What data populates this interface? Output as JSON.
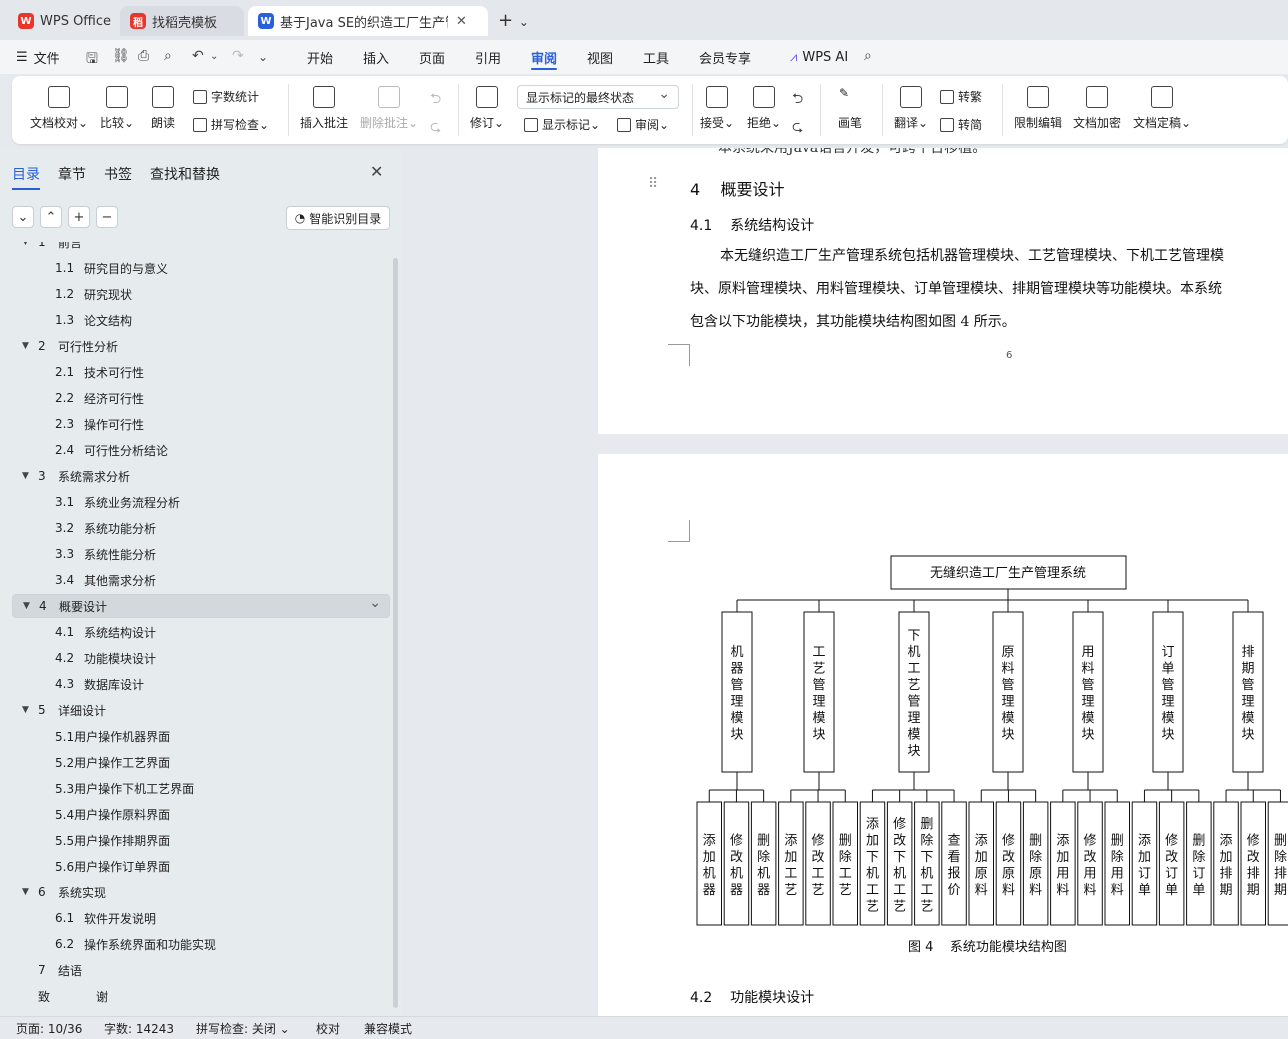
{
  "tabs": [
    {
      "label": "WPS Office",
      "icon": "wps-logo-icon",
      "color": "#e8362d"
    },
    {
      "label": "找稻壳模板",
      "icon": "docer-icon",
      "color": "#e8362d"
    },
    {
      "label": "基于Java SE的织造工厂生产管",
      "icon": "word-doc-icon",
      "color": "#2b5fd9"
    }
  ],
  "menu": {
    "file": "文件",
    "items": [
      "开始",
      "插入",
      "页面",
      "引用",
      "审阅",
      "视图",
      "工具",
      "会员专享"
    ],
    "active": "审阅",
    "ai": "WPS AI"
  },
  "ribbon": {
    "doc_check": "文档校对",
    "compare": "比较",
    "read": "朗读",
    "word_count": "字数统计",
    "spell": "拼写检查",
    "insert_comment": "插入批注",
    "delete_comment": "删除批注",
    "revise": "修订",
    "markup_state": "显示标记的最终状态",
    "show_markup": "显示标记",
    "review": "审阅",
    "accept": "接受",
    "reject": "拒绝",
    "pen": "画笔",
    "translate": "翻译",
    "to_trad": "转繁",
    "to_simp": "转简",
    "restrict": "限制编辑",
    "encrypt": "文档加密",
    "finalize": "文档定稿"
  },
  "panel": {
    "tabs": [
      "目录",
      "章节",
      "书签",
      "查找和替换"
    ],
    "smart": "智能识别目录",
    "toc": [
      {
        "num": "1",
        "text": "前言",
        "level": 1
      },
      {
        "num": "1.1",
        "text": "研究目的与意义",
        "level": 2
      },
      {
        "num": "1.2",
        "text": "研究现状",
        "level": 2
      },
      {
        "num": "1.3",
        "text": "论文结构",
        "level": 2
      },
      {
        "num": "2",
        "text": "可行性分析",
        "level": 1
      },
      {
        "num": "2.1",
        "text": "技术可行性",
        "level": 2
      },
      {
        "num": "2.2",
        "text": "经济可行性",
        "level": 2
      },
      {
        "num": "2.3",
        "text": "操作可行性",
        "level": 2
      },
      {
        "num": "2.4",
        "text": "可行性分析结论",
        "level": 2
      },
      {
        "num": "3",
        "text": "系统需求分析",
        "level": 1
      },
      {
        "num": "3.1",
        "text": "系统业务流程分析",
        "level": 2
      },
      {
        "num": "3.2",
        "text": "系统功能分析",
        "level": 2
      },
      {
        "num": "3.3",
        "text": "系统性能分析",
        "level": 2
      },
      {
        "num": "3.4",
        "text": "其他需求分析",
        "level": 2
      },
      {
        "num": "4",
        "text": "概要设计",
        "level": 1,
        "selected": true
      },
      {
        "num": "4.1",
        "text": "系统结构设计",
        "level": 2
      },
      {
        "num": "4.2",
        "text": "功能模块设计",
        "level": 2
      },
      {
        "num": "4.3",
        "text": "数据库设计",
        "level": 2
      },
      {
        "num": "5",
        "text": "详细设计",
        "level": 1
      },
      {
        "num": "",
        "text": "5.1用户操作机器界面",
        "level": 2
      },
      {
        "num": "",
        "text": "5.2用户操作工艺界面",
        "level": 2
      },
      {
        "num": "",
        "text": "5.3用户操作下机工艺界面",
        "level": 2
      },
      {
        "num": "",
        "text": "5.4用户操作原料界面",
        "level": 2
      },
      {
        "num": "",
        "text": "5.5用户操作排期界面",
        "level": 2
      },
      {
        "num": "",
        "text": "5.6用户操作订单界面",
        "level": 2
      },
      {
        "num": "6",
        "text": "系统实现",
        "level": 1
      },
      {
        "num": "6.1",
        "text": "软件开发说明",
        "level": 2
      },
      {
        "num": "6.2",
        "text": "操作系统界面和功能实现",
        "level": 2
      },
      {
        "num": "7",
        "text": "结语",
        "level": 0
      },
      {
        "num": "致",
        "text": "谢",
        "level": 0
      }
    ]
  },
  "doc": {
    "cut_line": "本系统采用Java语言开发，可跨平台移植。",
    "h1_num": "4",
    "h1": "概要设计",
    "h2_num": "4.1",
    "h2": "系统结构设计",
    "para": [
      "本无缝织造工厂生产管理系统包括机器管理模块、工艺管理模块、下机工艺管理模",
      "块、原料管理模块、用料管理模块、订单管理模块、排期管理模块等功能模块。本系统",
      "包含以下功能模块，其功能模块结构图如图 4 所示。"
    ],
    "page_no": "6",
    "chart_title": "无缝织造工厂生产管理系统",
    "modules": [
      "机器管理模块",
      "工艺管理模块",
      "下机工艺管理模块",
      "原料管理模块",
      "用料管理模块",
      "订单管理模块",
      "排期管理模块"
    ],
    "leaves": [
      [
        "添加机器",
        "修改机器",
        "删除机器"
      ],
      [
        "添加工艺",
        "修改工艺",
        "删除工艺"
      ],
      [
        "添加下机工艺",
        "修改下机工艺",
        "删除下机工艺",
        "查看报价"
      ],
      [
        "添加原料",
        "修改原料",
        "删除原料"
      ],
      [
        "添加用料",
        "修改用料",
        "删除用料"
      ],
      [
        "添加订单",
        "修改订单",
        "删除订单"
      ],
      [
        "添加排期",
        "修改排期",
        "删除排期"
      ]
    ],
    "fig_caption": "图 4    系统功能模块结构图",
    "h2b_num": "4.2",
    "h2b": "功能模块设计"
  },
  "status": {
    "page": "页面: 10/36",
    "words": "字数: 14243",
    "spell": "拼写检查: 关闭",
    "proof": "校对",
    "compat": "兼容模式"
  }
}
